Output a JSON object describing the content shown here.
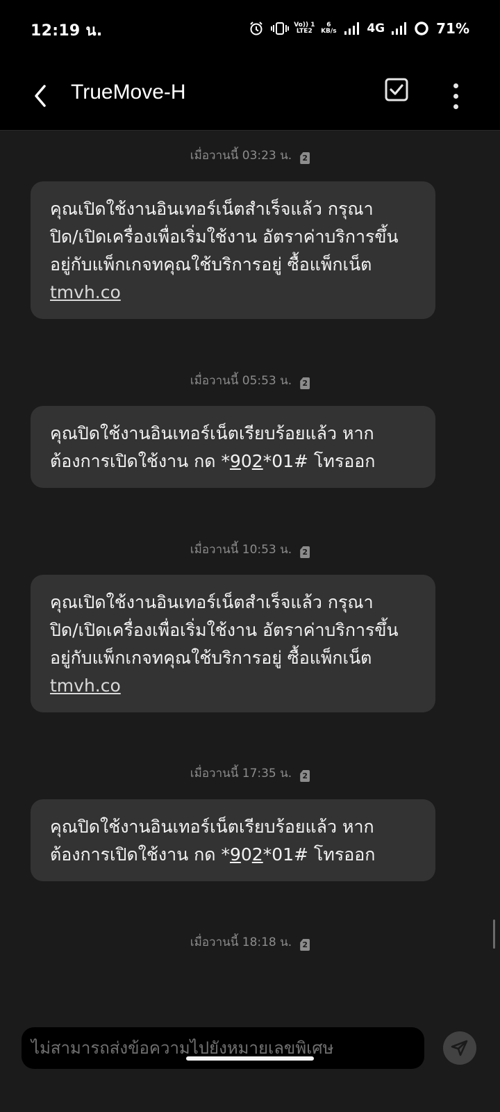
{
  "status_bar": {
    "time": "12:19 น.",
    "volte_label": "Vo)) 1\nLTE2",
    "data_rate": "6\nKB/s",
    "network_type": "4G",
    "battery_percent": "71%"
  },
  "app_bar": {
    "title": "TrueMove-H",
    "back_icon": "back-arrow-icon",
    "select_icon": "checkbox-icon",
    "more_icon": "more-vertical-icon"
  },
  "messages": [
    {
      "timestamp": "เมื่อวานนี้ 03:23 น.",
      "sim": "2",
      "lines": [
        "คุณเปิดใช้งานอินเทอร์เน็ตสำเร็จแล้ว กรุณา",
        "ปิด/เปิดเครื่องเพื่อเริ่มใช้งาน อัตราค่าบริการขึ้น",
        "อยู่กับแพ็กเกจทคุณใช้บริการอยู่ ซื้อแพ็กเน็ต"
      ],
      "link": "tmvh.co"
    },
    {
      "timestamp": "เมื่อวานนี้ 05:53 น.",
      "sim": "2",
      "line1": "คุณปิดใช้งานอินเทอร์เน็ตเรียบร้อยแล้ว หาก",
      "line2_prefix": "ต้องการเปิดใช้งาน กด *",
      "digit_a": "9",
      "digit_b": "0",
      "digit_c": "2",
      "line2_suffix": "*01# โทรออก"
    },
    {
      "timestamp": "เมื่อวานนี้ 10:53 น.",
      "sim": "2",
      "lines": [
        "คุณเปิดใช้งานอินเทอร์เน็ตสำเร็จแล้ว กรุณา",
        "ปิด/เปิดเครื่องเพื่อเริ่มใช้งาน อัตราค่าบริการขึ้น",
        "อยู่กับแพ็กเกจทคุณใช้บริการอยู่ ซื้อแพ็กเน็ต"
      ],
      "link": "tmvh.co"
    },
    {
      "timestamp": "เมื่อวานนี้ 17:35 น.",
      "sim": "2",
      "line1": "คุณปิดใช้งานอินเทอร์เน็ตเรียบร้อยแล้ว หาก",
      "line2_prefix": "ต้องการเปิดใช้งาน กด *",
      "digit_a": "9",
      "digit_b": "0",
      "digit_c": "2",
      "line2_suffix": "*01# โทรออก"
    },
    {
      "timestamp": "เมื่อวานนี้ 18:18 น.",
      "sim": "2"
    }
  ],
  "composer": {
    "placeholder": "ไม่สามารถส่งข้อความไปยังหมายเลขพิเศษ",
    "send_icon": "send-icon"
  }
}
